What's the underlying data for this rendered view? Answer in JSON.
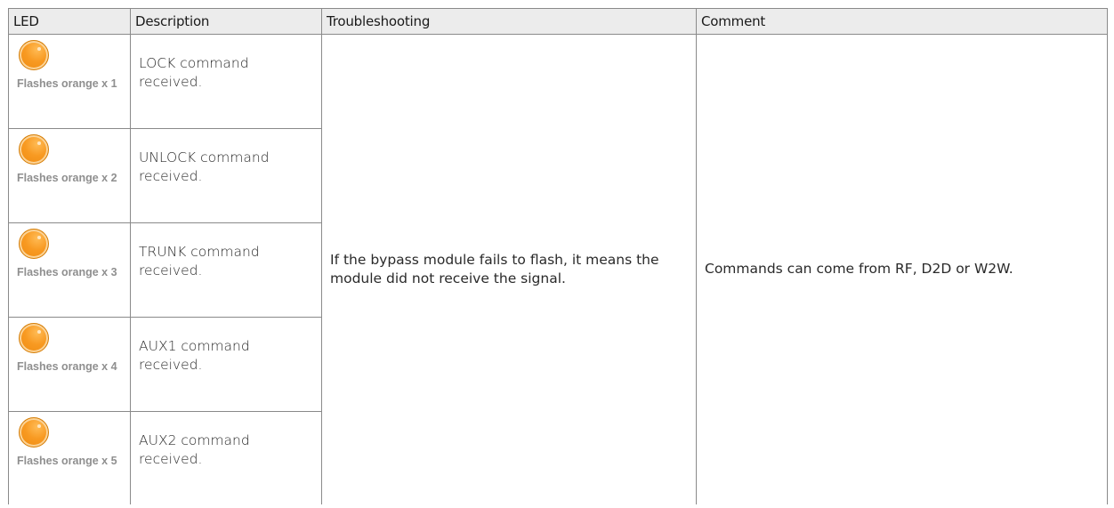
{
  "table": {
    "headers": {
      "led": "LED",
      "description": "Description",
      "troubleshooting": "Troubleshooting",
      "comment": "Comment"
    },
    "rows": [
      {
        "led_label": "Flashes orange x 1",
        "description": "LOCK command received."
      },
      {
        "led_label": "Flashes orange x 2",
        "description": "UNLOCK command received."
      },
      {
        "led_label": "Flashes orange x 3",
        "description": "TRUNK command received."
      },
      {
        "led_label": "Flashes orange x 4",
        "description": "AUX1 command received."
      },
      {
        "led_label": "Flashes orange x 5",
        "description": "AUX2 command received."
      }
    ],
    "troubleshooting": "If the bypass module fails to flash, it means the module did not receive the signal.",
    "comment": "Commands can come from RF, D2D or W2W.",
    "led_color": "#F7931E",
    "led_icon": "orange-led-icon"
  }
}
